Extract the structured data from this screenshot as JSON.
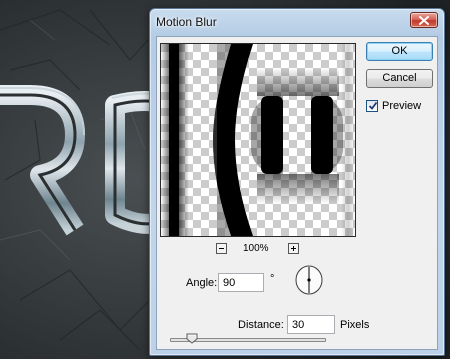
{
  "dialog": {
    "title": "Motion Blur",
    "ok_label": "OK",
    "cancel_label": "Cancel",
    "preview_label": "Preview",
    "preview_checked": true
  },
  "preview": {
    "zoom_level": "100%"
  },
  "angle": {
    "label": "Angle:",
    "value": "90",
    "unit": "°"
  },
  "distance": {
    "label": "Distance:",
    "value": "30",
    "unit": "Pixels",
    "slider_fraction": 0.14
  },
  "background": {
    "artwork_text": "ROU"
  },
  "colors": {
    "title_bar": "#b9d1ea",
    "close_button": "#c94a3c",
    "ok_button_glow": "#a7d9f5",
    "client_face": "#f0f0f0"
  },
  "icons": [
    "close-icon",
    "checkmark-icon",
    "zoom-out-icon",
    "zoom-in-icon",
    "angle-dial-icon",
    "slider-thumb-icon"
  ]
}
